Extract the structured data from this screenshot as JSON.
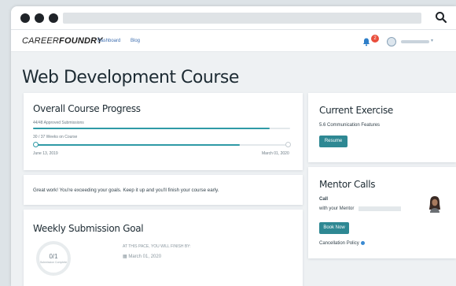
{
  "nav": {
    "logo_light": "CAREER",
    "logo_bold": "FOUNDRY",
    "links": [
      "Dashboard",
      "Blog"
    ],
    "notification_count": "2"
  },
  "page_title": "Web Development Course",
  "progress": {
    "title": "Overall Course Progress",
    "submissions_label": "44/48 Approved Submissions",
    "submissions_fraction": 0.92,
    "weeks_label": "30 / 37 Weeks on Course",
    "weeks_fraction": 0.81,
    "start_date": "June 13, 2019",
    "end_date": "March 01, 2020"
  },
  "message": "Great work! You're exceeding your goals. Keep it up and you'll finish your course early.",
  "goal": {
    "title": "Weekly Submission Goal",
    "ring_value": "0/1",
    "ring_caption": "Submission Complete",
    "pace_label": "AT THIS PACE, YOU WILL FINISH BY:",
    "finish_date": "March 01, 2020"
  },
  "exercise": {
    "title": "Current Exercise",
    "name": "5.6 Communication Features",
    "button": "Resume"
  },
  "mentor": {
    "title": "Mentor Calls",
    "call_label": "Call",
    "with_label": "with your Mentor",
    "button": "Book Now",
    "policy": "Cancellation Policy"
  },
  "colors": {
    "accent": "#2e8893",
    "badge": "#e94e3c",
    "background": "#eef1f3"
  }
}
